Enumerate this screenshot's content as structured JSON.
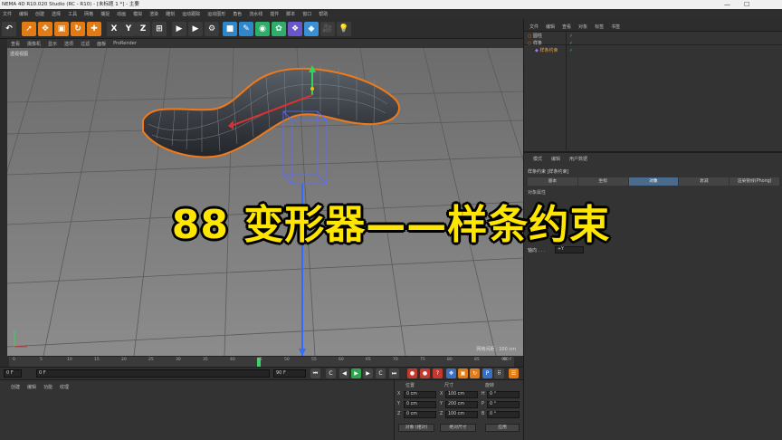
{
  "window": {
    "title": "NEMA 4D R10.020 Studio (RC - R10) - [未标题 1 *] - 主要",
    "minimize": "—",
    "maximize": "☐"
  },
  "menu": [
    "文件",
    "编辑",
    "创建",
    "选择",
    "工具",
    "网格",
    "捕捉",
    "动画",
    "模拟",
    "渲染",
    "雕刻",
    "运动跟踪",
    "运动图形",
    "角色",
    "流水线",
    "插件",
    "脚本",
    "窗口",
    "帮助"
  ],
  "toolbar": {
    "buttons": [
      {
        "name": "undo-button",
        "glyph": "↶",
        "color": "#3b3b3b"
      },
      {
        "name": "live-select-button",
        "glyph": "➚",
        "color": "#e37b14"
      },
      {
        "name": "move-button",
        "glyph": "✥",
        "color": "#e37b14"
      },
      {
        "name": "scale-button",
        "glyph": "▣",
        "color": "#e37b14"
      },
      {
        "name": "rotate-button",
        "glyph": "↻",
        "color": "#e37b14"
      },
      {
        "name": "recent-tool-button",
        "glyph": "✚",
        "color": "#e37b14"
      },
      {
        "name": "x-axis-button",
        "glyph": "X",
        "color": "#3b3b3b"
      },
      {
        "name": "y-axis-button",
        "glyph": "Y",
        "color": "#3b3b3b"
      },
      {
        "name": "z-axis-button",
        "glyph": "Z",
        "color": "#3b3b3b"
      },
      {
        "name": "coordinate-system-button",
        "glyph": "⊞",
        "color": "#3b3b3b"
      },
      {
        "name": "render-view-button",
        "glyph": "▶",
        "color": "#3b3b3b"
      },
      {
        "name": "render-picture-viewer-button",
        "glyph": "▶",
        "color": "#3b3b3b"
      },
      {
        "name": "render-settings-button",
        "glyph": "⚙",
        "color": "#3b3b3b"
      },
      {
        "name": "cube-button",
        "glyph": "■",
        "color": "#2f86c9"
      },
      {
        "name": "pen-spline-button",
        "glyph": "✎",
        "color": "#2f86c9"
      },
      {
        "name": "subdivision-button",
        "glyph": "◉",
        "color": "#2fae6b"
      },
      {
        "name": "array-button",
        "glyph": "✿",
        "color": "#2fae6b"
      },
      {
        "name": "deformer-button",
        "glyph": "❖",
        "color": "#6a56c8"
      },
      {
        "name": "environment-button",
        "glyph": "◆",
        "color": "#3b8fd6"
      },
      {
        "name": "camera-button",
        "glyph": "🎥",
        "color": "#3b3b3b"
      },
      {
        "name": "light-button",
        "glyph": "💡",
        "color": "#3b3b3b"
      }
    ]
  },
  "viewport": {
    "menu": [
      "查看",
      "摄像机",
      "显示",
      "选项",
      "过滤",
      "面板",
      "ProRender"
    ],
    "label": "透视视图",
    "scale_text": "网格间距 : 100 cm"
  },
  "timeline": {
    "ticks": [
      "0",
      "5",
      "10",
      "15",
      "20",
      "25",
      "30",
      "35",
      "40",
      "45",
      "50",
      "55",
      "60",
      "65",
      "70",
      "75",
      "80",
      "85",
      "90"
    ],
    "current_frame": 45,
    "end_label": "90 F"
  },
  "transport": {
    "start": "0 F",
    "current": "0 F",
    "end": "90 F",
    "end2": "90 F"
  },
  "material": {
    "menu": [
      "创建",
      "编辑",
      "功能",
      "纹理"
    ]
  },
  "coordinates": {
    "headers": [
      "位置",
      "尺寸",
      "旋转"
    ],
    "rows": [
      {
        "axis": "X",
        "pos": "0 cm",
        "size_axis": "X",
        "size": "100 cm",
        "rot_axis": "H",
        "rot": "0 °"
      },
      {
        "axis": "Y",
        "pos": "0 cm",
        "size_axis": "Y",
        "size": "200 cm",
        "rot_axis": "P",
        "rot": "0 °"
      },
      {
        "axis": "Z",
        "pos": "0 cm",
        "size_axis": "Z",
        "size": "100 cm",
        "rot_axis": "B",
        "rot": "0 °"
      }
    ],
    "mode_select": "对象 (相对)",
    "size_select": "绝对尺寸",
    "apply": "应用"
  },
  "objects": {
    "menu": [
      "文件",
      "编辑",
      "查看",
      "对象",
      "标签",
      "书签"
    ],
    "items": [
      {
        "label": "圆柱",
        "indent": 0
      },
      {
        "label": "样条",
        "indent": 0
      },
      {
        "label": "样条约束",
        "indent": 1
      }
    ]
  },
  "attributes": {
    "menu": [
      "模式",
      "编辑",
      "用户数据"
    ],
    "object_label": "样条约束 [样条约束]",
    "tabs": [
      "基本",
      "坐标",
      "对象",
      "衰减",
      "渲染管线(Phong)"
    ],
    "active_tab": 2,
    "section": "对象属性",
    "axis_label": "轴向 . . .",
    "axis_value": "+Y"
  },
  "overlay": {
    "title": "88 变形器——样条约束"
  },
  "colors": {
    "accent_orange": "#e37b14",
    "title_yellow": "#ffe600",
    "timeline_marker": "#3fd06c",
    "active_tab": "#4b6b8c"
  }
}
